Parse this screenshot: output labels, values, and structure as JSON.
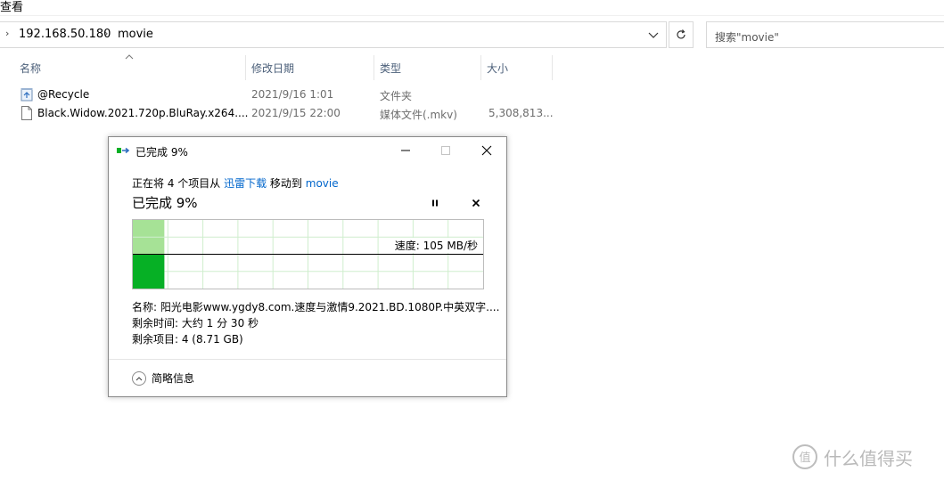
{
  "ribbon": {
    "tab_label": "查看"
  },
  "address": {
    "parts": [
      "192.168.50.180",
      "movie"
    ]
  },
  "search": {
    "placeholder": "搜索\"movie\""
  },
  "columns": [
    "名称",
    "修改日期",
    "类型",
    "大小"
  ],
  "files": [
    {
      "name": "@Recycle",
      "date": "2021/9/16 1:01",
      "type": "文件夹",
      "size": ""
    },
    {
      "name": "Black.Widow.2021.720p.BluRay.x264....",
      "date": "2021/9/15 22:00",
      "type": "媒体文件(.mkv)",
      "size": "5,308,813..."
    }
  ],
  "dialog": {
    "title": "已完成 9%",
    "line_prefix": "正在将 4 个项目从 ",
    "source": "迅雷下载",
    "line_middle": " 移动到 ",
    "destination": "movie",
    "big_status": "已完成 9%",
    "progress_fraction": 0.09,
    "speed": "速度: 105 MB/秒",
    "name_line": "名称: 阳光电影www.ygdy8.com.速度与激情9.2021.BD.1080P.中英双字....",
    "time_line": "剩余时间: 大约 1 分 30 秒",
    "items_line": "剩余项目: 4 (8.71 GB)",
    "details_label": "简略信息"
  },
  "watermark": {
    "text": "什么值得买",
    "logo": "值"
  },
  "colors": {
    "progress_green": "#06b025",
    "progress_light": "#a6e296",
    "link": "#0066cc"
  }
}
